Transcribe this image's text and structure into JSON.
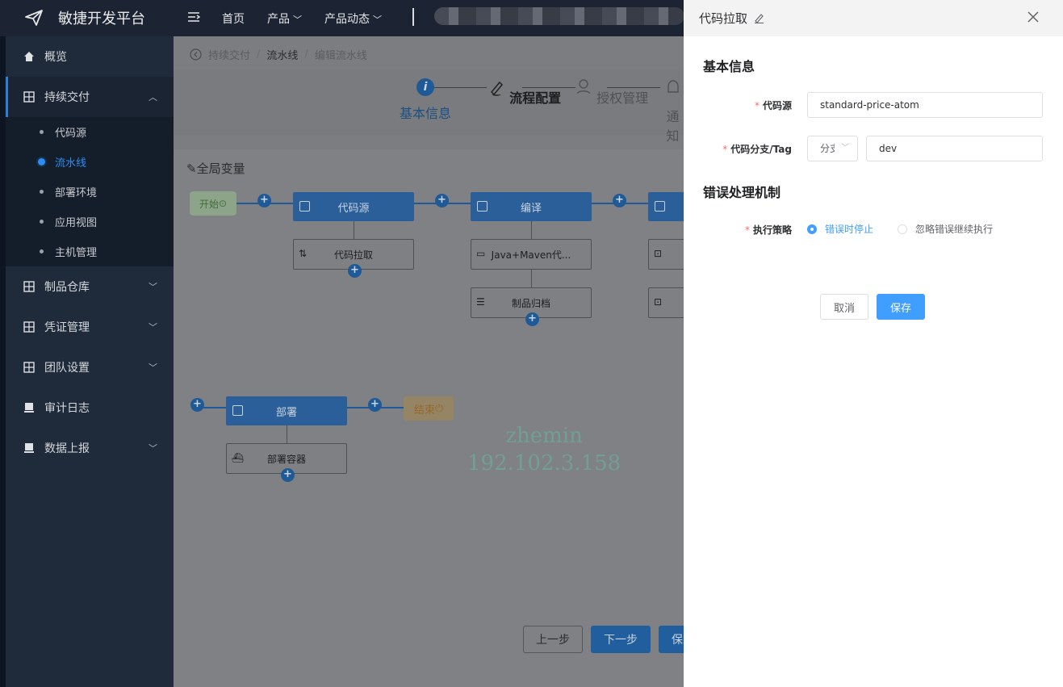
{
  "header": {
    "title": "敏捷开发平台",
    "nav": [
      {
        "label": "首页"
      },
      {
        "label": "产品"
      },
      {
        "label": "产品动态"
      }
    ]
  },
  "sidebar": {
    "items": [
      {
        "label": "概览"
      },
      {
        "label": "持续交付"
      },
      {
        "label": "制品仓库"
      },
      {
        "label": "凭证管理"
      },
      {
        "label": "团队设置"
      },
      {
        "label": "审计日志"
      },
      {
        "label": "数据上报"
      }
    ],
    "sub_items": [
      {
        "label": "代码源"
      },
      {
        "label": "流水线"
      },
      {
        "label": "部署环境"
      },
      {
        "label": "应用视图"
      },
      {
        "label": "主机管理"
      }
    ]
  },
  "breadcrumb": {
    "items": [
      "持续交付",
      "流水线",
      "编辑流水线"
    ],
    "separator": "/"
  },
  "steps": [
    {
      "label": "基本信息"
    },
    {
      "label": "流程配置"
    },
    {
      "label": "授权管理"
    },
    {
      "label": "通知"
    }
  ],
  "canvas": {
    "global_var_label": "全局变量",
    "start_label": "开始",
    "end_label": "结束",
    "stages": [
      {
        "label": "代码源"
      },
      {
        "label": "编译"
      },
      {
        "label": "部署"
      }
    ],
    "tasks": [
      {
        "label": "代码拉取"
      },
      {
        "label": "Java+Maven代..."
      },
      {
        "label": "制品归档"
      },
      {
        "label": "部署容器"
      }
    ],
    "watermark": {
      "line1": "zhemin",
      "line2": "192.102.3.158"
    }
  },
  "footer_buttons": {
    "prev": "上一步",
    "next": "下一步",
    "save": "保"
  },
  "drawer": {
    "title": "代码拉取",
    "section_basic": "基本信息",
    "label_source": "代码源",
    "source_value": "standard-price-atom",
    "label_branch": "代码分支/Tag",
    "branch_type": "分支",
    "branch_value": "dev",
    "section_error": "错误处理机制",
    "label_strategy": "执行策略",
    "strategy_options": [
      {
        "label": "错误时停止",
        "checked": true
      },
      {
        "label": "忽略错误继续执行",
        "checked": false
      }
    ],
    "cancel_label": "取消",
    "save_label": "保存"
  },
  "colors": {
    "primary": "#409eff",
    "sidebar_bg": "#1f2b3b",
    "header_bg": "#1c2434",
    "required": "#f56c6c"
  }
}
